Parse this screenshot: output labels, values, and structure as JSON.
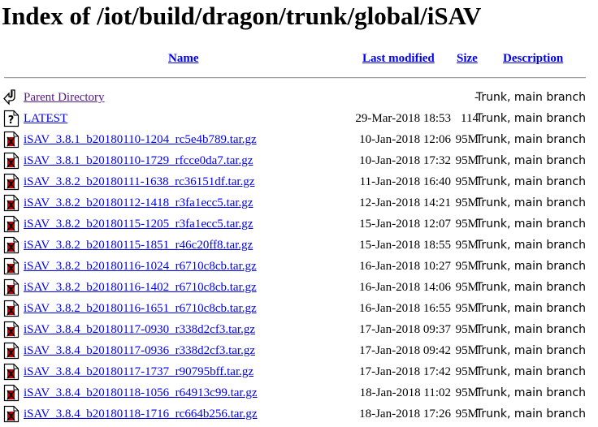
{
  "page": {
    "title": "Index of /iot/build/dragon/trunk/global/iSAV"
  },
  "columns": {
    "name": "Name",
    "modified": "Last modified",
    "size": "Size",
    "description": "Description"
  },
  "colors": {
    "link": "#0000ee",
    "visited": "#551a8b",
    "rule": "#a0a0a0"
  },
  "rows": [
    {
      "icon": "back-icon",
      "name": "Parent Directory",
      "modified": "",
      "size": "-",
      "description": "Trunk, main branch",
      "visited": true
    },
    {
      "icon": "unknown-file-icon",
      "name": "LATEST",
      "modified": "29-Mar-2018 18:53",
      "size": "114",
      "description": "Trunk, main branch"
    },
    {
      "icon": "archive-file-icon",
      "name": "iSAV_3.8.1_b20180110-1204_rc5e4b789.tar.gz",
      "modified": "10-Jan-2018 12:06",
      "size": "95M",
      "description": "Trunk, main branch"
    },
    {
      "icon": "archive-file-icon",
      "name": "iSAV_3.8.1_b20180110-1729_rfcce0da7.tar.gz",
      "modified": "10-Jan-2018 17:32",
      "size": "95M",
      "description": "Trunk, main branch"
    },
    {
      "icon": "archive-file-icon",
      "name": "iSAV_3.8.2_b20180111-1638_rc36151df.tar.gz",
      "modified": "11-Jan-2018 16:40",
      "size": "95M",
      "description": "Trunk, main branch"
    },
    {
      "icon": "archive-file-icon",
      "name": "iSAV_3.8.2_b20180112-1418_r3fa1ecc5.tar.gz",
      "modified": "12-Jan-2018 14:21",
      "size": "95M",
      "description": "Trunk, main branch"
    },
    {
      "icon": "archive-file-icon",
      "name": "iSAV_3.8.2_b20180115-1205_r3fa1ecc5.tar.gz",
      "modified": "15-Jan-2018 12:07",
      "size": "95M",
      "description": "Trunk, main branch"
    },
    {
      "icon": "archive-file-icon",
      "name": "iSAV_3.8.2_b20180115-1851_r46c20ff8.tar.gz",
      "modified": "15-Jan-2018 18:55",
      "size": "95M",
      "description": "Trunk, main branch"
    },
    {
      "icon": "archive-file-icon",
      "name": "iSAV_3.8.2_b20180116-1024_r6710c8cb.tar.gz",
      "modified": "16-Jan-2018 10:27",
      "size": "95M",
      "description": "Trunk, main branch"
    },
    {
      "icon": "archive-file-icon",
      "name": "iSAV_3.8.2_b20180116-1402_r6710c8cb.tar.gz",
      "modified": "16-Jan-2018 14:06",
      "size": "95M",
      "description": "Trunk, main branch"
    },
    {
      "icon": "archive-file-icon",
      "name": "iSAV_3.8.2_b20180116-1651_r6710c8cb.tar.gz",
      "modified": "16-Jan-2018 16:55",
      "size": "95M",
      "description": "Trunk, main branch"
    },
    {
      "icon": "archive-file-icon",
      "name": "iSAV_3.8.4_b20180117-0930_r338d2cf3.tar.gz",
      "modified": "17-Jan-2018 09:37",
      "size": "95M",
      "description": "Trunk, main branch"
    },
    {
      "icon": "archive-file-icon",
      "name": "iSAV_3.8.4_b20180117-0936_r338d2cf3.tar.gz",
      "modified": "17-Jan-2018 09:42",
      "size": "95M",
      "description": "Trunk, main branch"
    },
    {
      "icon": "archive-file-icon",
      "name": "iSAV_3.8.4_b20180117-1737_r90795bff.tar.gz",
      "modified": "17-Jan-2018 17:42",
      "size": "95M",
      "description": "Trunk, main branch"
    },
    {
      "icon": "archive-file-icon",
      "name": "iSAV_3.8.4_b20180118-1056_r64913c99.tar.gz",
      "modified": "18-Jan-2018 11:02",
      "size": "95M",
      "description": "Trunk, main branch"
    },
    {
      "icon": "archive-file-icon",
      "name": "iSAV_3.8.4_b20180118-1716_rc664b256.tar.gz",
      "modified": "18-Jan-2018 17:26",
      "size": "95M",
      "description": "Trunk, main branch"
    }
  ]
}
